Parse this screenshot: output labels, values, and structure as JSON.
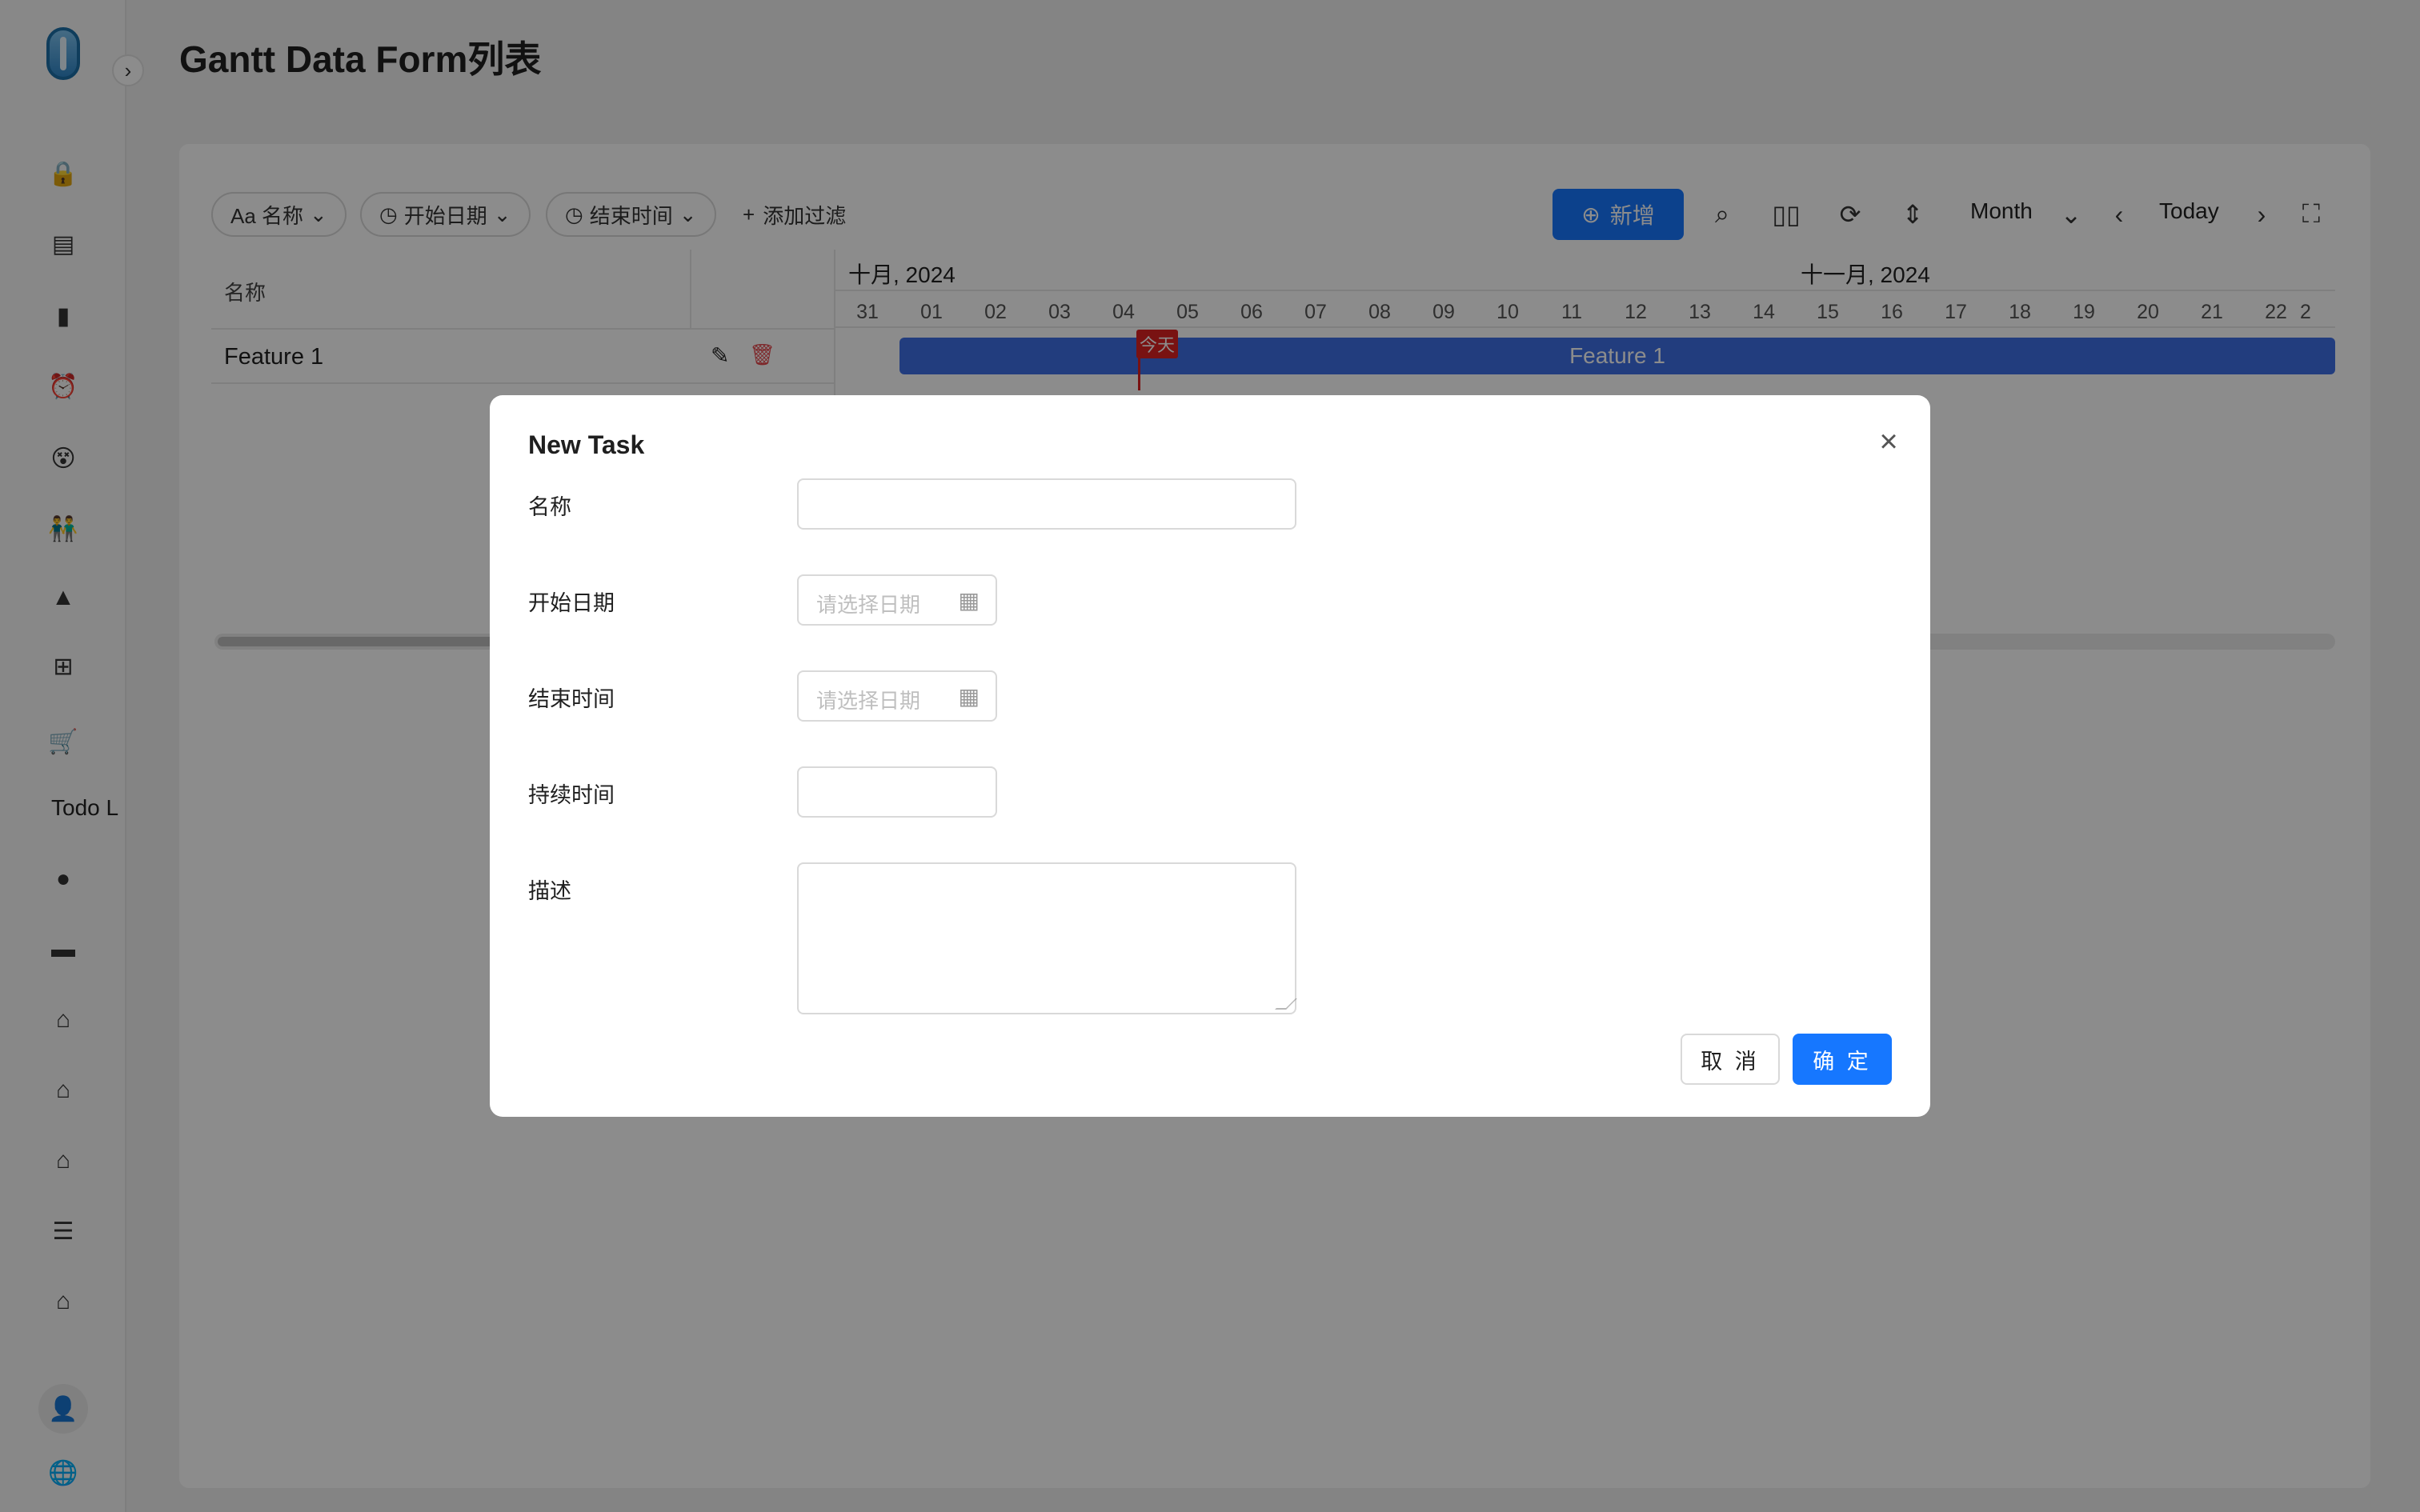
{
  "page": {
    "title": "Gantt Data Form列表"
  },
  "sidebar": {
    "icons": [
      "lock-icon",
      "document-icon",
      "battery-icon",
      "alarm-icon",
      "emoji-icon",
      "people-icon",
      "tree-icon",
      "flow-icon",
      "cart-icon",
      "globe-icon",
      "folder-icon",
      "home-icon",
      "home-icon",
      "home-icon",
      "menu-icon",
      "home-outline-icon"
    ],
    "text_item": "Todo L",
    "user_icon": "user-icon",
    "language_icon": "globe-icon"
  },
  "toolbar": {
    "filters": [
      {
        "label": "Aa 名称"
      },
      {
        "label": "开始日期"
      },
      {
        "label": "结束时间"
      }
    ],
    "add_filter": "添加过滤",
    "add_button": "新增",
    "view_mode": "Month",
    "today": "Today"
  },
  "gantt": {
    "column_name": "名称",
    "rows": [
      {
        "name": "Feature 1"
      }
    ],
    "months": [
      "十月, 2024",
      "十一月, 2024"
    ],
    "days": [
      "31",
      "01",
      "02",
      "03",
      "04",
      "05",
      "06",
      "07",
      "08",
      "09",
      "10",
      "11",
      "12",
      "13",
      "14",
      "15",
      "16",
      "17",
      "18",
      "19",
      "20",
      "21",
      "22",
      "2"
    ],
    "today_label": "今天",
    "bar_label": "Feature 1"
  },
  "modal": {
    "title": "New Task",
    "fields": {
      "name": {
        "label": "名称",
        "value": ""
      },
      "start": {
        "label": "开始日期",
        "placeholder": "请选择日期"
      },
      "end": {
        "label": "结束时间",
        "placeholder": "请选择日期"
      },
      "duration": {
        "label": "持续时间",
        "value": ""
      },
      "description": {
        "label": "描述",
        "value": ""
      }
    },
    "cancel": "取 消",
    "ok": "确 定"
  },
  "colors": {
    "primary": "#1677ff",
    "bar": "#3f6fe6",
    "today": "#dd2222"
  }
}
